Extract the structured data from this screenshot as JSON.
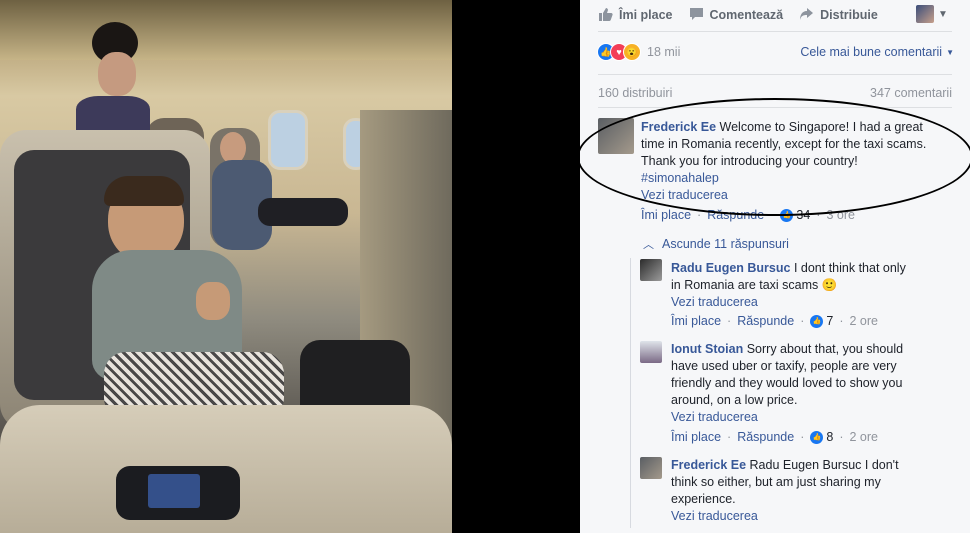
{
  "actions": {
    "like": "Îmi place",
    "comment": "Comentează",
    "share": "Distribuie"
  },
  "reactions": {
    "count": "18 mii",
    "sort_label": "Cele mai bune comentarii"
  },
  "stats": {
    "shares": "160 distribuiri",
    "comments": "347 comentarii"
  },
  "comments": [
    {
      "author": "Frederick Ee",
      "text_lines": [
        "Welcome to Singapore! I had a great",
        "time in Romania recently, except for the taxi scams.",
        "Thank you for introducing your country!"
      ],
      "hashtag": "#simonahalep",
      "translate": "Vezi traducerea",
      "like": "Îmi place",
      "reply": "Răspunde",
      "likes": "34",
      "time": "3 ore"
    }
  ],
  "hide_replies": "Ascunde 11 răspunsuri",
  "replies": [
    {
      "author": "Radu Eugen Bursuc",
      "text_lines": [
        "I dont think that only",
        "in Romania are taxi scams"
      ],
      "emoji": "🙂",
      "translate": "Vezi traducerea",
      "like": "Îmi place",
      "reply": "Răspunde",
      "likes": "7",
      "time": "2 ore"
    },
    {
      "author": "Ionut Stoian",
      "text_lines": [
        "Sorry about that, you should",
        "have used uber or taxify, people are very",
        "friendly and they would loved to show you",
        "around, on a low price."
      ],
      "translate": "Vezi traducerea",
      "like": "Îmi place",
      "reply": "Răspunde",
      "likes": "8",
      "time": "2 ore"
    },
    {
      "author": "Frederick Ee",
      "text_lines": [
        "Radu Eugen Bursuc I don't",
        "think so either, but am just sharing my",
        "experience."
      ],
      "translate": "Vezi traducerea"
    }
  ],
  "colors": {
    "link": "#385898",
    "like_blue": "#1877f2",
    "love_red": "#f33e58",
    "panel_bg": "#f6f7f9"
  }
}
